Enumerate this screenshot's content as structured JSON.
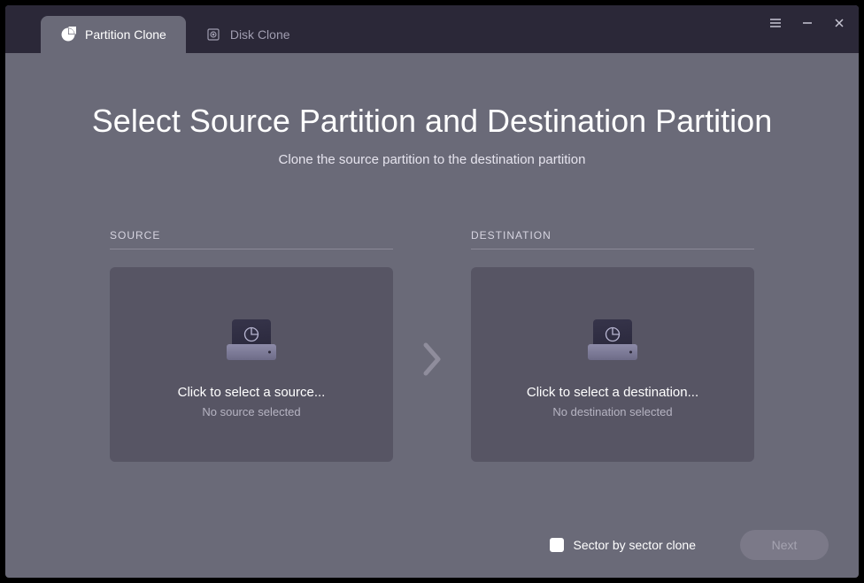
{
  "tabs": {
    "partition_clone": "Partition Clone",
    "disk_clone": "Disk Clone"
  },
  "page": {
    "title": "Select Source Partition and Destination Partition",
    "subtitle": "Clone the source partition to the destination partition"
  },
  "source": {
    "label": "SOURCE",
    "primary": "Click to select a source...",
    "secondary": "No source selected"
  },
  "destination": {
    "label": "DESTINATION",
    "primary": "Click to select a destination...",
    "secondary": "No destination selected"
  },
  "footer": {
    "sector_label": "Sector by sector clone",
    "next_label": "Next"
  }
}
